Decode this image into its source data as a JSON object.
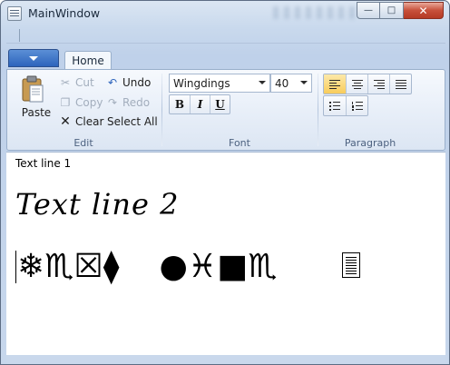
{
  "window": {
    "title": "MainWindow",
    "caption_buttons": {
      "minimize": "—",
      "maximize": "□",
      "close": "✕"
    }
  },
  "ribbon": {
    "app_menu_icon": "chevron-down-icon",
    "tabs": [
      {
        "label": "Home",
        "selected": true
      }
    ],
    "groups": {
      "edit": {
        "label": "Edit",
        "paste": "Paste",
        "cut": "Cut",
        "copy": "Copy",
        "clear": "Clear",
        "undo": "Undo",
        "redo": "Redo",
        "select_all": "Select All"
      },
      "font": {
        "label": "Font",
        "family": "Wingdings",
        "size": "40",
        "bold": "B",
        "italic": "I",
        "underline": "U"
      },
      "paragraph": {
        "label": "Paragraph",
        "align_left_active": true
      }
    }
  },
  "editor": {
    "line1": "Text line 1",
    "line2": "Text line 2",
    "line3_group1": "❄♏☒⧫",
    "line3_group2": "●♓■♏"
  },
  "colors": {
    "accent_blue": "#2d64bc",
    "active_button": "#f8cc5b",
    "close_red": "#c7503a"
  }
}
